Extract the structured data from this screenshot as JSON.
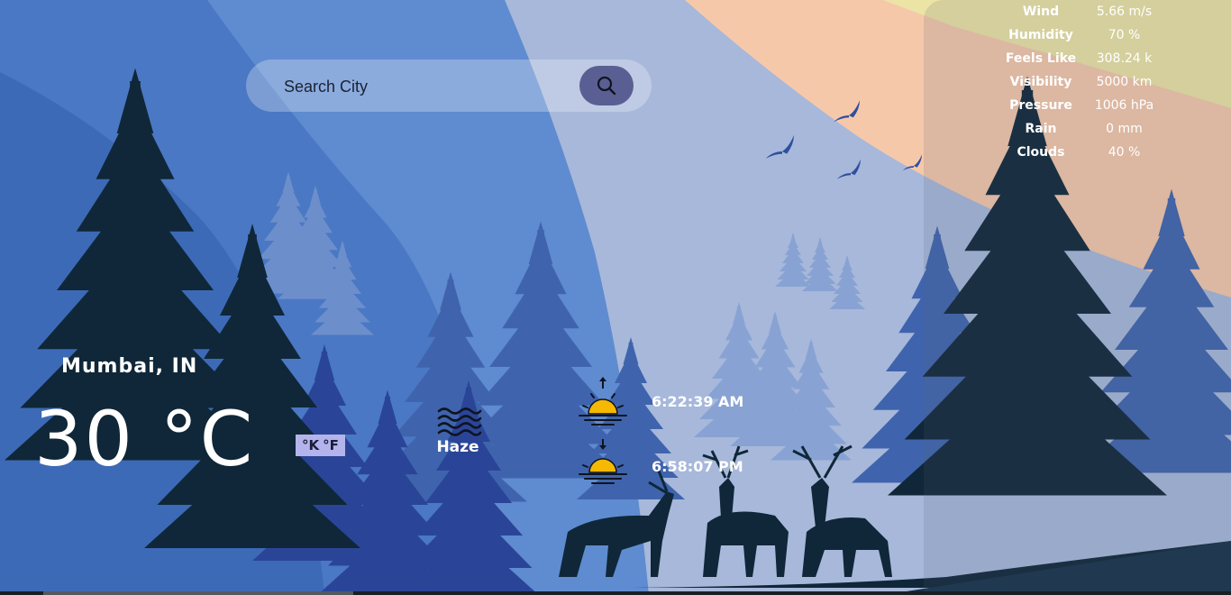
{
  "search": {
    "placeholder": "Search City"
  },
  "location": {
    "city": "Mumbai,",
    "country": "IN"
  },
  "current": {
    "temperature": "30 °C",
    "condition": "Haze"
  },
  "units": {
    "kelvin": "°K",
    "fahrenheit": "°F"
  },
  "sun": {
    "sunrise": "6:22:39 AM",
    "sunset": "6:58:07 PM"
  },
  "details": [
    {
      "label": "Wind",
      "value": "5.66 m/s"
    },
    {
      "label": "Humidity",
      "value": "70 %"
    },
    {
      "label": "Feels Like",
      "value": "308.24 k"
    },
    {
      "label": "Visibility",
      "value": "5000 km"
    },
    {
      "label": "Pressure",
      "value": "1006 hPa"
    },
    {
      "label": "Rain",
      "value": "0 mm"
    },
    {
      "label": "Clouds",
      "value": "40 %"
    }
  ],
  "colors": {
    "sky_dark": "#3f6fbf",
    "sky_light": "#a9b8d8",
    "peach": "#f6c7a8",
    "yellow": "#e8e2a0",
    "tree_dark": "#0f2738",
    "sun": "#f6b800"
  }
}
